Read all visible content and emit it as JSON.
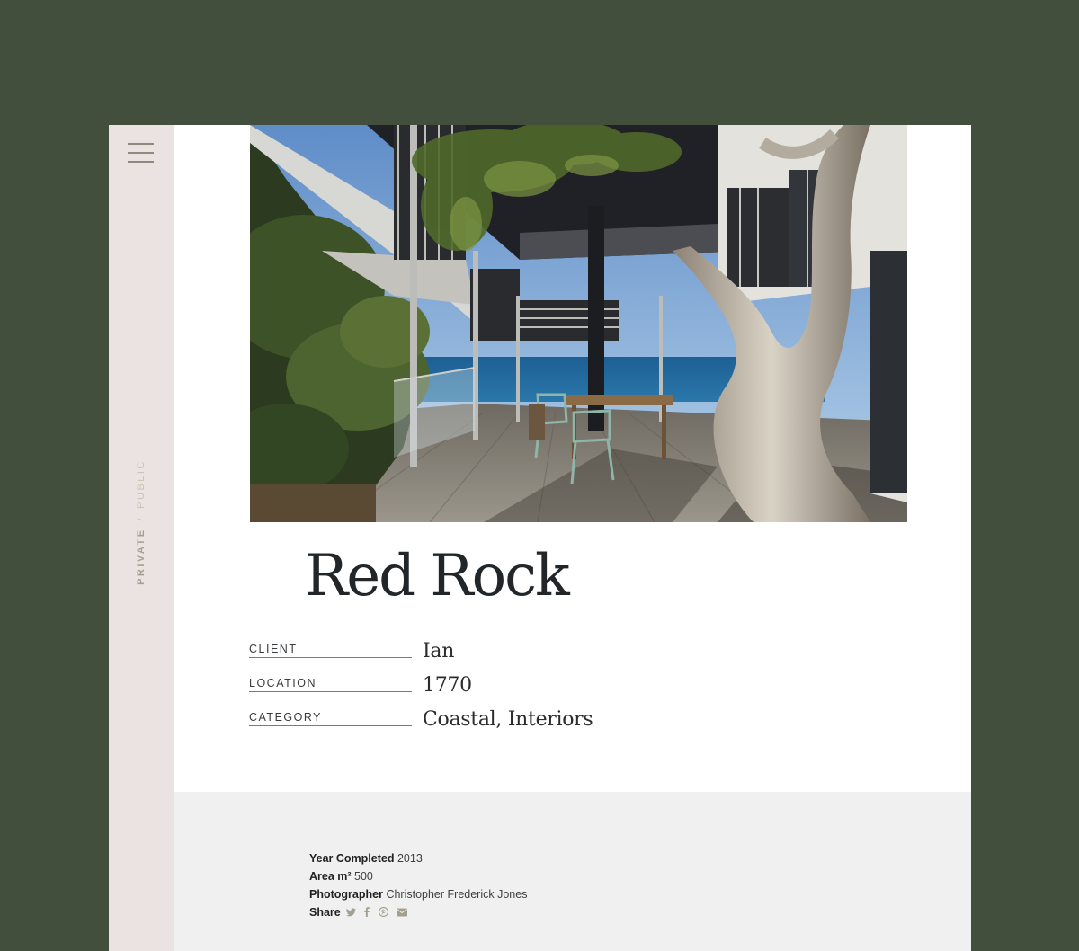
{
  "project": {
    "title": "Red Rock"
  },
  "sidebar": {
    "toggle_private": "PRIVATE",
    "toggle_separator": "/",
    "toggle_public": "PUBLIC"
  },
  "details": {
    "client_label": "CLIENT",
    "client_value": "Ian",
    "location_label": "LOCATION",
    "location_value": "1770",
    "category_label": "CATEGORY",
    "category_value": "Coastal, Interiors"
  },
  "facts": {
    "year_label": "Year Completed",
    "year_value": "2013",
    "area_label": "Area m²",
    "area_value": "500",
    "photographer_label": "Photographer",
    "photographer_value": "Christopher Frederick Jones",
    "share_label": "Share"
  },
  "share_icons": [
    "twitter-icon",
    "facebook-icon",
    "pinterest-icon",
    "email-icon"
  ],
  "colors": {
    "background": "#424f3c",
    "sidebar": "#ebe3e2",
    "footer": "#f0f0f0",
    "title": "#222629",
    "icon": "#a49f8e"
  }
}
